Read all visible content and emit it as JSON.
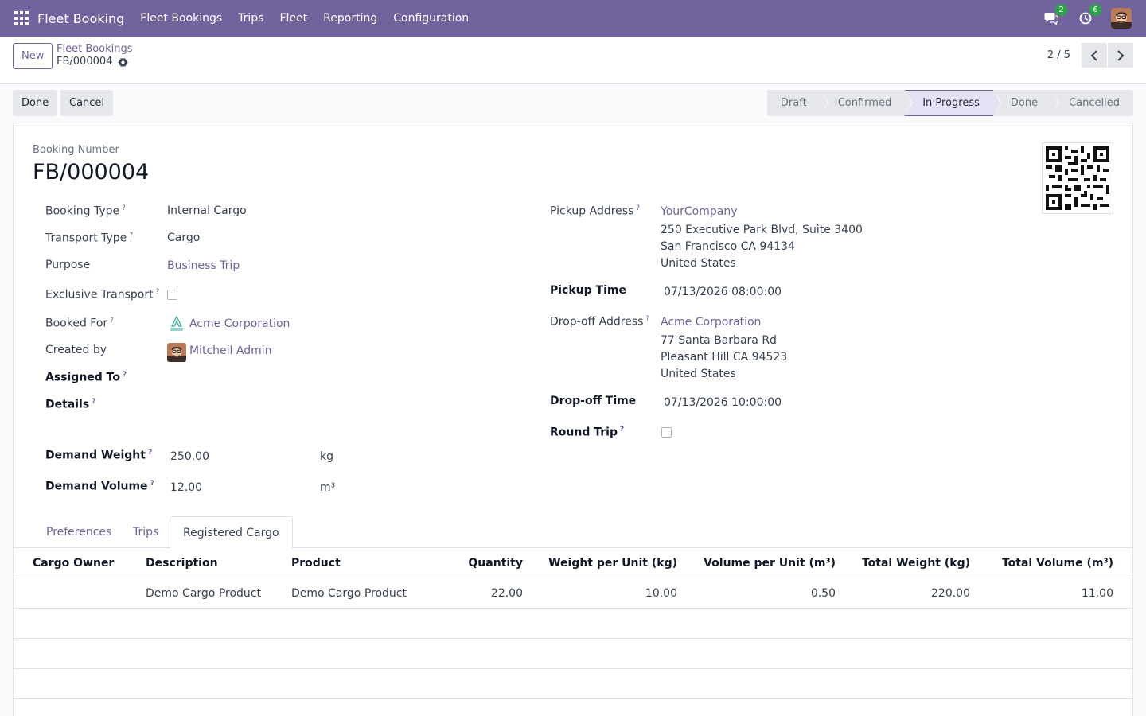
{
  "nav": {
    "brand": "Fleet Booking",
    "menu": [
      "Fleet Bookings",
      "Trips",
      "Fleet",
      "Reporting",
      "Configuration"
    ],
    "messages_count": "2",
    "activities_count": "6"
  },
  "control": {
    "new_label": "New",
    "breadcrumb_parent": "Fleet Bookings",
    "breadcrumb_current": "FB/000004",
    "pager": "2 / 5"
  },
  "actions": {
    "done_label": "Done",
    "cancel_label": "Cancel"
  },
  "stages": {
    "items": [
      "Draft",
      "Confirmed",
      "In Progress",
      "Done",
      "Cancelled"
    ],
    "active": "In Progress"
  },
  "form": {
    "booking_number_label": "Booking Number",
    "booking_number": "FB/000004",
    "booking_type_label": "Booking Type",
    "booking_type": "Internal Cargo",
    "transport_type_label": "Transport Type",
    "transport_type": "Cargo",
    "purpose_label": "Purpose",
    "purpose": "Business Trip",
    "exclusive_transport_label": "Exclusive Transport",
    "booked_for_label": "Booked For",
    "booked_for": "Acme Corporation",
    "created_by_label": "Created by",
    "created_by": "Mitchell Admin",
    "assigned_to_label": "Assigned To",
    "details_label": "Details",
    "demand_weight_label": "Demand Weight",
    "demand_weight": "250.00",
    "demand_weight_unit": "kg",
    "demand_volume_label": "Demand Volume",
    "demand_volume": "12.00",
    "demand_volume_unit": "m³",
    "pickup_address_label": "Pickup Address",
    "pickup_address": {
      "name": "YourCompany",
      "line1": "250 Executive Park Blvd, Suite 3400",
      "line2": "San Francisco CA 94134",
      "line3": "United States"
    },
    "pickup_time_label": "Pickup Time",
    "pickup_time": "07/13/2026 08:00:00",
    "dropoff_address_label": "Drop-off Address",
    "dropoff_address": {
      "name": "Acme Corporation",
      "line1": "77 Santa Barbara Rd",
      "line2": "Pleasant Hill CA 94523",
      "line3": "United States"
    },
    "dropoff_time_label": "Drop-off Time",
    "dropoff_time": "07/13/2026 10:00:00",
    "round_trip_label": "Round Trip",
    "help_mark": "?"
  },
  "tabs": [
    "Preferences",
    "Trips",
    "Registered Cargo"
  ],
  "cargo_table": {
    "columns": [
      "Cargo Owner",
      "Description",
      "Product",
      "Quantity",
      "Weight per Unit (kg)",
      "Volume per Unit (m³)",
      "Total Weight (kg)",
      "Total Volume (m³)"
    ],
    "rows": [
      {
        "owner": "",
        "description": "Demo Cargo Product",
        "product": "Demo Cargo Product",
        "quantity": "22.00",
        "weight_unit": "10.00",
        "volume_unit": "0.50",
        "total_weight": "220.00",
        "total_volume": "11.00"
      }
    ]
  },
  "colors": {
    "brand": "#71639e",
    "badge": "#28a745",
    "active_stage": "#e6e0f5"
  },
  "icons": [
    "apps-grid-icon",
    "chat-icon",
    "clock-icon",
    "gear-icon",
    "chevron-left-icon",
    "chevron-right-icon",
    "qr-code-icon",
    "acme-logo-icon",
    "avatar"
  ]
}
